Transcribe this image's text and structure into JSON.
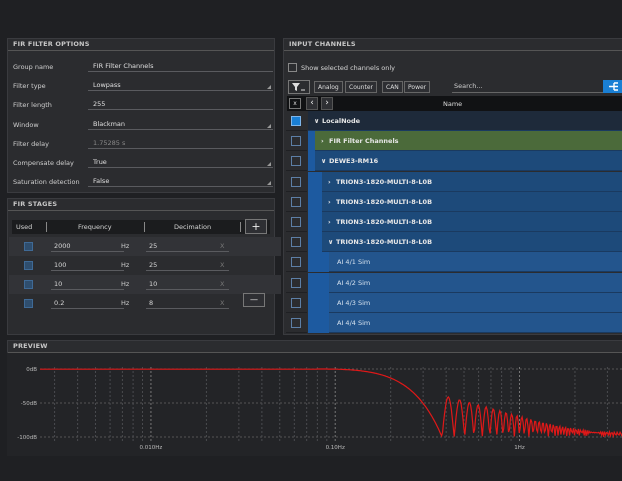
{
  "fir_options": {
    "title": "FIR FILTER OPTIONS",
    "fields": [
      {
        "label": "Group name",
        "value": "FIR Filter Channels",
        "dropdown": false,
        "dim": false
      },
      {
        "label": "Filter type",
        "value": "Lowpass",
        "dropdown": true,
        "dim": false
      },
      {
        "label": "Filter length",
        "value": "255",
        "dropdown": false,
        "dim": false
      },
      {
        "label": "Window",
        "value": "Blackman",
        "dropdown": true,
        "dim": false
      },
      {
        "label": "Filter delay",
        "value": "1.75285 s",
        "dropdown": false,
        "dim": true
      },
      {
        "label": "Compensate delay",
        "value": "True",
        "dropdown": true,
        "dim": false
      },
      {
        "label": "Saturation detection",
        "value": "False",
        "dropdown": true,
        "dim": false
      }
    ]
  },
  "fir_stages": {
    "title": "FIR STAGES",
    "headers": {
      "used": "Used",
      "frequency": "Frequency",
      "decimation": "Decimation",
      "add": "+"
    },
    "rows": [
      {
        "frequency": "2000",
        "unit": "Hz",
        "decimation": "25",
        "x": "X"
      },
      {
        "frequency": "100",
        "unit": "Hz",
        "decimation": "25",
        "x": "X"
      },
      {
        "frequency": "10",
        "unit": "Hz",
        "decimation": "10",
        "x": "X"
      },
      {
        "frequency": "0.2",
        "unit": "Hz",
        "decimation": "8",
        "x": "X"
      }
    ],
    "remove": "—"
  },
  "input_channels": {
    "title": "INPUT CHANNELS",
    "show_selected": "Show selected channels only",
    "filters": [
      "Analog",
      "Counter",
      "CAN",
      "Power"
    ],
    "search_placeholder": "Search...",
    "name_header": "Name",
    "header_x": "x",
    "rows": [
      {
        "label": "LocalNode",
        "prefix": "∨",
        "level": 0
      },
      {
        "label": "FIR Filter Channels",
        "prefix": "›",
        "level": 1
      },
      {
        "label": "DEWE3-RM16",
        "prefix": "∨",
        "level": 1
      },
      {
        "label": "TRION3-1820-MULTI-8-L0B",
        "prefix": "›",
        "level": 2
      },
      {
        "label": "TRION3-1820-MULTI-8-L0B",
        "prefix": "›",
        "level": 2
      },
      {
        "label": "TRION3-1820-MULTI-8-L0B",
        "prefix": "›",
        "level": 2
      },
      {
        "label": "TRION3-1820-MULTI-8-L0B",
        "prefix": "∨",
        "level": 2
      },
      {
        "label": "AI 4/1 Sim",
        "prefix": "",
        "level": 3
      },
      {
        "label": "AI 4/2 Sim",
        "prefix": "",
        "level": 3
      },
      {
        "label": "AI 4/3 Sim",
        "prefix": "",
        "level": 3
      },
      {
        "label": "AI 4/4 Sim",
        "prefix": "",
        "level": 3
      }
    ]
  },
  "preview": {
    "title": "PREVIEW",
    "y_ticks": [
      "0dB",
      "-50dB",
      "-100dB"
    ],
    "x_ticks": [
      "0.010Hz",
      "0.10Hz",
      "1Hz"
    ]
  },
  "colors": {
    "curve": "#e01818",
    "selection": "#1d4a7a",
    "fir_row": "#4b6a3a",
    "accent": "#1a7fd4"
  }
}
